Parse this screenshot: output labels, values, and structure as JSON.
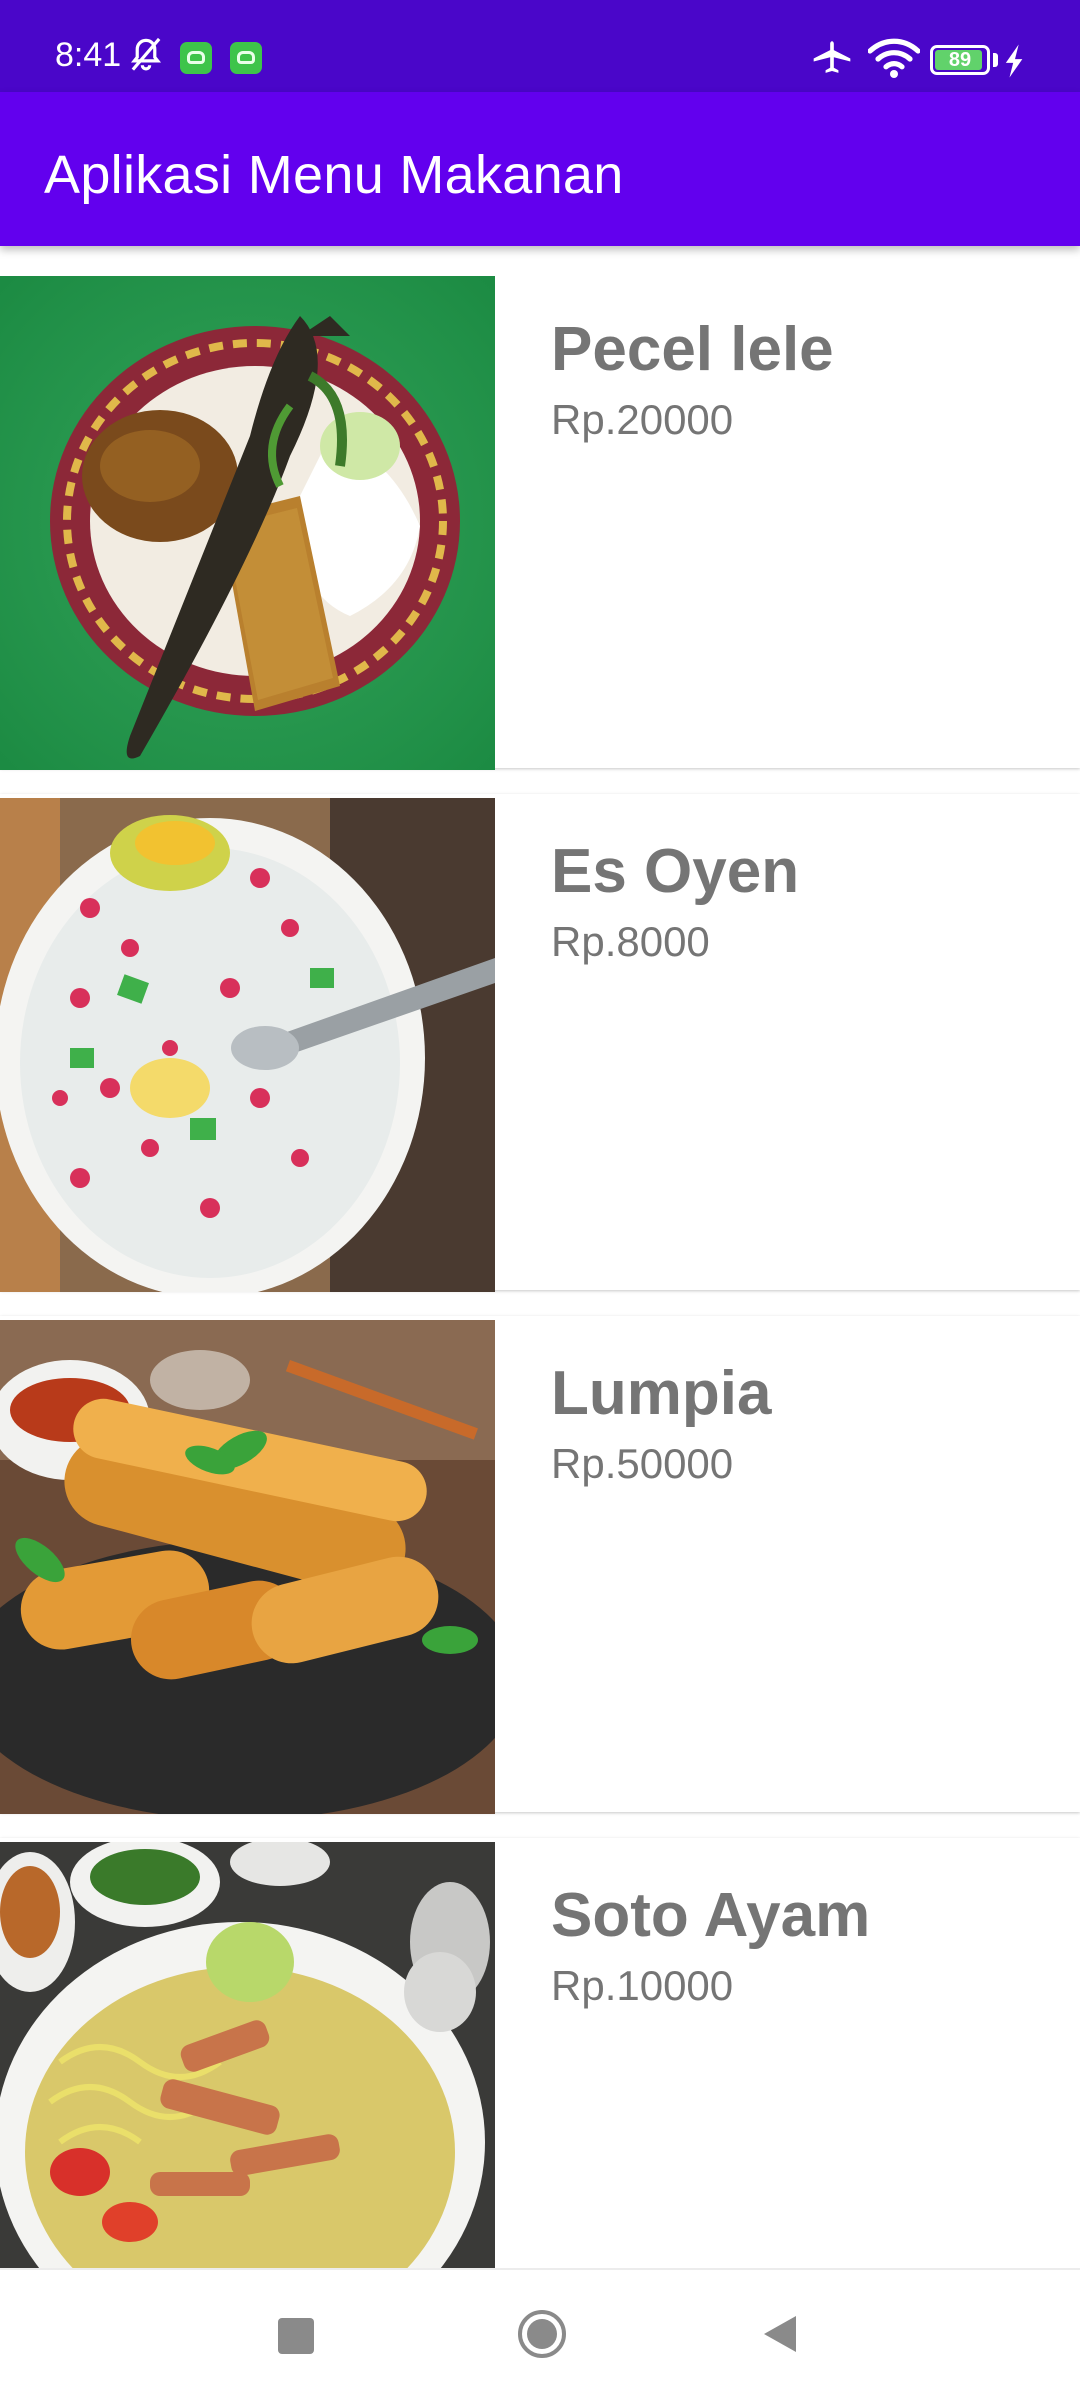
{
  "status_bar": {
    "time": "8:41",
    "battery_level": "89",
    "battery_fraction": 0.89,
    "icons": [
      "bell-off-icon",
      "app-notification-icon",
      "app-notification-icon",
      "airplane-icon",
      "wifi-icon",
      "battery-icon",
      "charging-icon"
    ],
    "colors": {
      "background": "#4a06c9",
      "battery_fill": "#61d26b"
    }
  },
  "app_bar": {
    "title": "Aplikasi Menu Makanan",
    "color": "#6200ee"
  },
  "menu": {
    "items": [
      {
        "name": "Pecel lele",
        "price": "Rp.20000",
        "image": "pecel-lele-photo"
      },
      {
        "name": "Es Oyen",
        "price": "Rp.8000",
        "image": "es-oyen-photo"
      },
      {
        "name": "Lumpia",
        "price": "Rp.50000",
        "image": "lumpia-photo"
      },
      {
        "name": "Soto Ayam",
        "price": "Rp.10000",
        "image": "soto-ayam-photo"
      }
    ]
  },
  "nav_bar": {
    "buttons": [
      "recents-icon",
      "home-icon",
      "back-icon"
    ]
  }
}
